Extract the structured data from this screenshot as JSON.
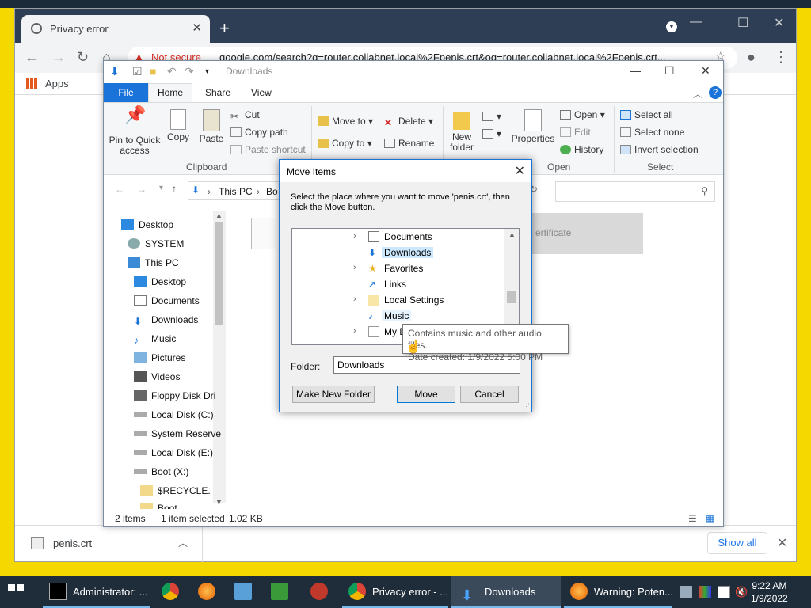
{
  "browser": {
    "tab_title": "Privacy error",
    "new_tab": "+",
    "security_label": "Not secure",
    "url": "google.com/search?q=router.collabnet.local%2Fpenis.crt&oq=router.collabnet.local%2Fpenis.crt...",
    "bookmarks_apps": "Apps",
    "download_file": "penis.crt",
    "show_all": "Show all"
  },
  "explorer": {
    "title": "Downloads",
    "ribbon_tabs": [
      "File",
      "Home",
      "Share",
      "View"
    ],
    "clipboard": {
      "pin": "Pin to Quick access",
      "copy": "Copy",
      "paste": "Paste",
      "cut": "Cut",
      "copy_path": "Copy path",
      "paste_shortcut": "Paste shortcut",
      "group": "Clipboard"
    },
    "organize": {
      "move_to": "Move to",
      "copy_to": "Copy to",
      "delete": "Delete",
      "rename": "Rename"
    },
    "new": {
      "new_folder": "New folder"
    },
    "open": {
      "properties": "Properties",
      "open": "Open",
      "edit": "Edit",
      "history": "History",
      "group": "Open"
    },
    "select": {
      "select_all": "Select all",
      "select_none": "Select none",
      "invert": "Invert selection",
      "group": "Select"
    },
    "breadcrumb": [
      "This PC",
      "Bo"
    ],
    "nav_items": [
      "Desktop",
      "SYSTEM",
      "This PC",
      "Desktop",
      "Documents",
      "Downloads",
      "Music",
      "Pictures",
      "Videos",
      "Floppy Disk Dri",
      "Local Disk (C:)",
      "System Reserve",
      "Local Disk (E:)",
      "Boot (X:)",
      "$RECYCLE.BIN",
      "Boot"
    ],
    "file_tile": "ertificate",
    "status": {
      "count": "2 items",
      "selected": "1 item selected",
      "size": "1.02 KB"
    }
  },
  "dialog": {
    "title": "Move Items",
    "message": "Select the place where you want to move 'penis.crt', then click the Move button.",
    "tree": [
      "Documents",
      "Downloads",
      "Favorites",
      "Links",
      "Local Settings",
      "Music",
      "My D"
    ],
    "folder_label": "Folder:",
    "folder_value": "Downloads",
    "make_new_folder": "Make New Folder",
    "move": "Move",
    "cancel": "Cancel",
    "tooltip_line1": "Contains music and other audio files.",
    "tooltip_line2": "Date created: 1/9/2022 5:00 PM",
    "tooltip_hidden_prefix": "N"
  },
  "taskbar": {
    "items": [
      "Administrator: ...",
      "Privacy error - ...",
      "Downloads",
      "Warning: Poten..."
    ],
    "time": "9:22 AM",
    "date": "1/9/2022"
  },
  "colors": {
    "accent": "#1a73d9",
    "desktop_bg": "#f4d800",
    "taskbar_bg": "#1f2d3b",
    "chrome_frame": "#2e3e54",
    "warn_red": "#d93025"
  }
}
